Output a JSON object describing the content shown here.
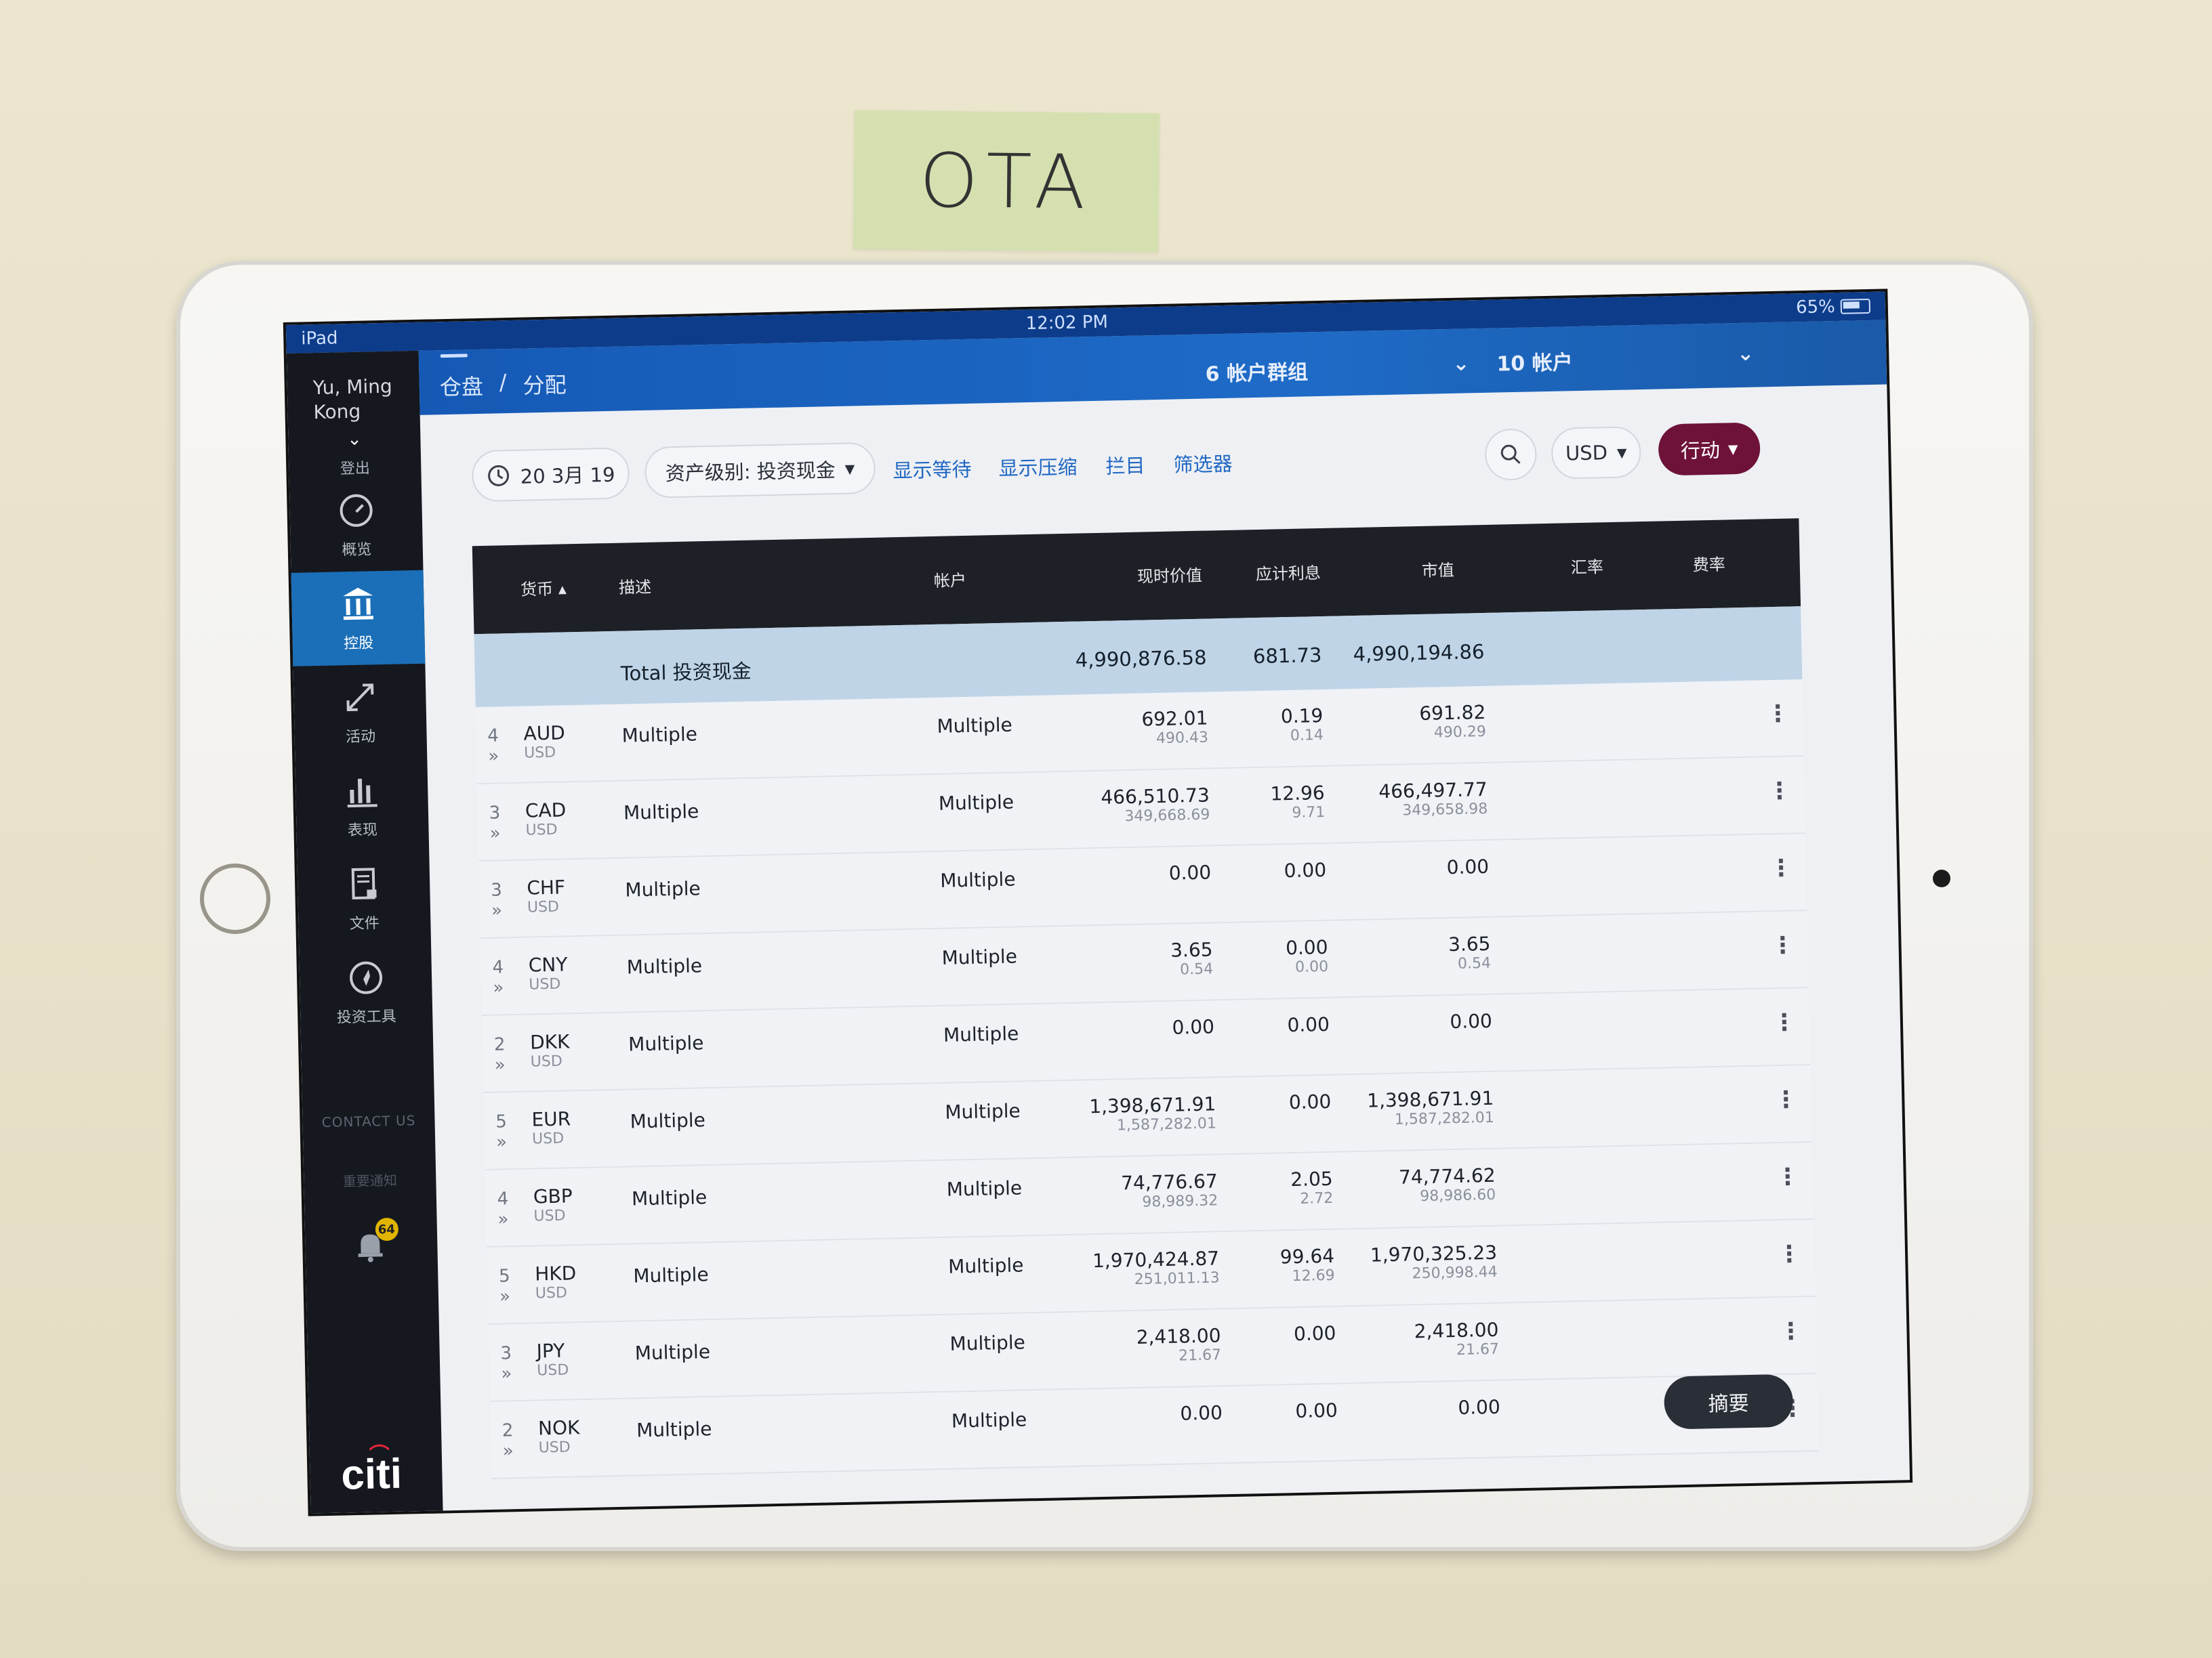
{
  "note": {
    "text": "OTA"
  },
  "status_bar": {
    "device": "iPad",
    "time": "12:02 PM",
    "battery": "65%"
  },
  "sidebar": {
    "user_name_line1": "Yu, Ming",
    "user_name_line2": "Kong",
    "logout": "登出",
    "items": [
      {
        "label": "概览",
        "icon": "gauge-icon"
      },
      {
        "label": "控股",
        "icon": "bank-icon"
      },
      {
        "label": "活动",
        "icon": "arrows-icon"
      },
      {
        "label": "表现",
        "icon": "bar-chart-icon"
      },
      {
        "label": "文件",
        "icon": "document-lock-icon"
      },
      {
        "label": "投资工具",
        "icon": "compass-icon"
      }
    ],
    "contact": "CONTACT US",
    "notice": "重要通知",
    "bell_count": "64",
    "logo": "citi"
  },
  "topbar": {
    "breadcrumb": [
      "仓盘",
      "/",
      "分配"
    ],
    "group_select": "6 帐户群组",
    "account_select": "10 帐户"
  },
  "toolbar": {
    "date": "20 3月 19",
    "asset_class": "资产级别: 投资现金",
    "links": [
      "显示等待",
      "显示压缩",
      "拦目",
      "筛选器"
    ],
    "currency": "USD",
    "action": "行动"
  },
  "table": {
    "headers": [
      "货币",
      "描述",
      "帐户",
      "现时价值",
      "应计利息",
      "市值",
      "汇率",
      "费率"
    ],
    "total": {
      "label": "Total 投资现金",
      "current_value": "4,990,876.58",
      "accrued": "681.73",
      "market_value": "4,990,194.86"
    },
    "rows": [
      {
        "count": "4",
        "ccy": "AUD",
        "base": "USD",
        "desc": "Multiple",
        "account": "Multiple",
        "cv": "692.01",
        "cv_sub": "490.43",
        "ai": "0.19",
        "ai_sub": "0.14",
        "mv": "691.82",
        "mv_sub": "490.29"
      },
      {
        "count": "3",
        "ccy": "CAD",
        "base": "USD",
        "desc": "Multiple",
        "account": "Multiple",
        "cv": "466,510.73",
        "cv_sub": "349,668.69",
        "ai": "12.96",
        "ai_sub": "9.71",
        "mv": "466,497.77",
        "mv_sub": "349,658.98"
      },
      {
        "count": "3",
        "ccy": "CHF",
        "base": "USD",
        "desc": "Multiple",
        "account": "Multiple",
        "cv": "0.00",
        "cv_sub": "",
        "ai": "0.00",
        "ai_sub": "",
        "mv": "0.00",
        "mv_sub": ""
      },
      {
        "count": "4",
        "ccy": "CNY",
        "base": "USD",
        "desc": "Multiple",
        "account": "Multiple",
        "cv": "3.65",
        "cv_sub": "0.54",
        "ai": "0.00",
        "ai_sub": "0.00",
        "mv": "3.65",
        "mv_sub": "0.54"
      },
      {
        "count": "2",
        "ccy": "DKK",
        "base": "USD",
        "desc": "Multiple",
        "account": "Multiple",
        "cv": "0.00",
        "cv_sub": "",
        "ai": "0.00",
        "ai_sub": "",
        "mv": "0.00",
        "mv_sub": ""
      },
      {
        "count": "5",
        "ccy": "EUR",
        "base": "USD",
        "desc": "Multiple",
        "account": "Multiple",
        "cv": "1,398,671.91",
        "cv_sub": "1,587,282.01",
        "ai": "0.00",
        "ai_sub": "",
        "mv": "1,398,671.91",
        "mv_sub": "1,587,282.01"
      },
      {
        "count": "4",
        "ccy": "GBP",
        "base": "USD",
        "desc": "Multiple",
        "account": "Multiple",
        "cv": "74,776.67",
        "cv_sub": "98,989.32",
        "ai": "2.05",
        "ai_sub": "2.72",
        "mv": "74,774.62",
        "mv_sub": "98,986.60"
      },
      {
        "count": "5",
        "ccy": "HKD",
        "base": "USD",
        "desc": "Multiple",
        "account": "Multiple",
        "cv": "1,970,424.87",
        "cv_sub": "251,011.13",
        "ai": "99.64",
        "ai_sub": "12.69",
        "mv": "1,970,325.23",
        "mv_sub": "250,998.44"
      },
      {
        "count": "3",
        "ccy": "JPY",
        "base": "USD",
        "desc": "Multiple",
        "account": "Multiple",
        "cv": "2,418.00",
        "cv_sub": "21.67",
        "ai": "0.00",
        "ai_sub": "",
        "mv": "2,418.00",
        "mv_sub": "21.67"
      },
      {
        "count": "2",
        "ccy": "NOK",
        "base": "USD",
        "desc": "Multiple",
        "account": "Multiple",
        "cv": "0.00",
        "cv_sub": "",
        "ai": "0.00",
        "ai_sub": "",
        "mv": "0.00",
        "mv_sub": ""
      }
    ]
  },
  "summary_button": "摘要",
  "colors": {
    "topbar": "#1559b5",
    "sidebar": "#15181f",
    "active_nav": "#1b6fb8",
    "action": "#6e1239",
    "total_row": "#bfd4e7"
  }
}
